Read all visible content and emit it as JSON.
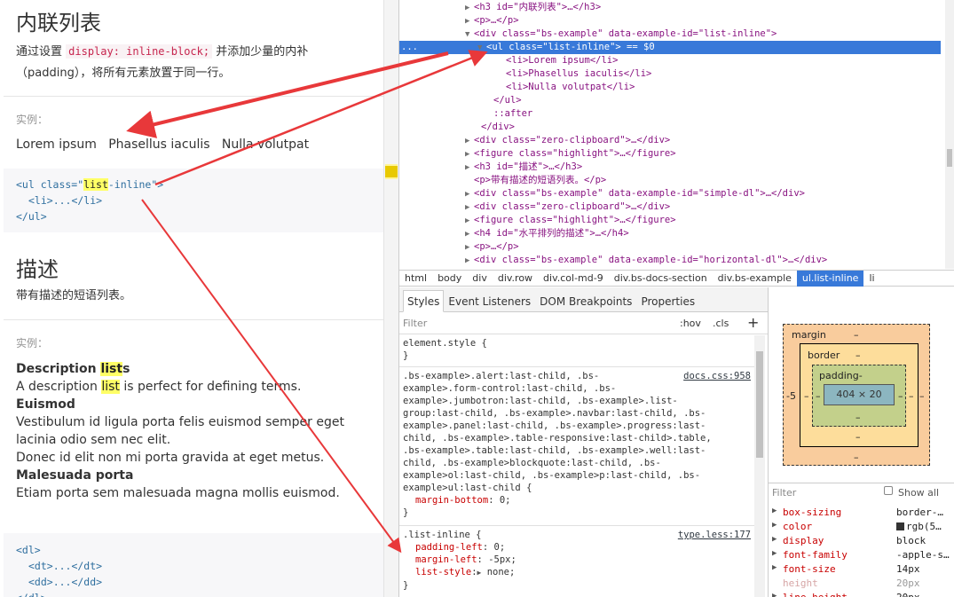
{
  "left": {
    "section1": {
      "title": "内联列表",
      "desc_prefix": "通过设置",
      "desc_code": "display: inline-block;",
      "desc_suffix1": "并添加少量的内补",
      "desc_suffix2": "（padding），将所有元素放置于同一行。"
    },
    "example_label": "实例：",
    "inline_items": [
      "Lorem ipsum",
      "Phasellus iaculis",
      "Nulla volutpat"
    ],
    "code1": {
      "line1_a": "<ul class=\"",
      "line1_hl": "list",
      "line1_b": "-inline\">",
      "line2": "<li>...</li>",
      "line3": "</ul>"
    },
    "section2": {
      "title": "描述",
      "desc": "带有描述的短语列表。"
    },
    "dl": {
      "term1_a": "Description ",
      "term1_hl": "list",
      "term1_b": "s",
      "def1_a": "A description ",
      "def1_hl": "list",
      "def1_b": " is perfect for defining terms.",
      "term2": "Euismod",
      "def2a": "Vestibulum id ligula porta felis euismod semper eget",
      "def2b": "lacinia odio sem nec elit.",
      "def2c": "Donec id elit non mi porta gravida at eget metus.",
      "term3": "Malesuada porta",
      "def3": "Etiam porta sem malesuada magna mollis euismod."
    },
    "code2": {
      "line1": "<dl>",
      "line2": "<dt>...</dt>",
      "line3": "<dd>...</dd>",
      "line4": "</dl>"
    }
  },
  "dom": {
    "rows": [
      "<h3 id=\"内联列表\">…</h3>",
      "<p>…</p>",
      "<div class=\"bs-example\" data-example-id=\"list-inline\">",
      "<ul class=\"list-inline\"> == $0",
      "<li>Lorem ipsum</li>",
      "<li>Phasellus iaculis</li>",
      "<li>Nulla volutpat</li>",
      "</ul>",
      "::after",
      "</div>",
      "<div class=\"zero-clipboard\">…</div>",
      "<figure class=\"highlight\">…</figure>",
      "<h3 id=\"描述\">…</h3>",
      "<p>带有描述的短语列表。</p>",
      "<div class=\"bs-example\" data-example-id=\"simple-dl\">…</div>",
      "<div class=\"zero-clipboard\">…</div>",
      "<figure class=\"highlight\">…</figure>",
      "<h4 id=\"水平排列的描述\">…</h4>",
      "<p>…</p>",
      "<div class=\"bs-example\" data-example-id=\"horizontal-dl\">…</div>"
    ],
    "ellipsis": "..."
  },
  "breadcrumbs": [
    "html",
    "body",
    "div",
    "div.row",
    "div.col-md-9",
    "div.bs-docs-section",
    "div.bs-example",
    "ul.list-inline",
    "li"
  ],
  "tabs": [
    "Styles",
    "Event Listeners",
    "DOM Breakpoints",
    "Properties"
  ],
  "styles": {
    "filter_placeholder": "Filter",
    "hov": ":hov",
    "cls": ".cls",
    "plus": "+",
    "element_style": "element.style {",
    "close": "}",
    "rule2_lines": [
      ".bs-example>.alert:last-child, .bs-",
      "example>.form-control:last-child, .bs-",
      "example>.jumbotron:last-child, .bs-example>.list-",
      "group:last-child, .bs-example>.navbar:last-child, .bs-",
      "example>.panel:last-child, .bs-example>.progress:last-",
      "child, .bs-example>.table-responsive:last-child>.table,",
      ".bs-example>.table:last-child, .bs-example>.well:last-",
      "child, .bs-example>blockquote:last-child, .bs-",
      "example>ol:last-child, .bs-example>p:last-child, .bs-",
      "example>ul:last-child {"
    ],
    "rule2_src": "docs.css:958",
    "rule2_prop": "margin-bottom",
    "rule2_val": "0;",
    "rule3_sel": ".list-inline {",
    "rule3_src": "type.less:177",
    "rule3_props": [
      {
        "k": "padding-left",
        "v": "0;"
      },
      {
        "k": "margin-left",
        "v": "-5px;"
      },
      {
        "k": "list-style",
        "v": "none;"
      }
    ]
  },
  "boxmodel": {
    "margin": "margin",
    "margin_top": "–",
    "margin_bottom": "–",
    "margin_left": "-5",
    "margin_right": "–",
    "border": "border",
    "border_top": "–",
    "border_bottom": "–",
    "border_left": "–",
    "border_right": "–",
    "padding": "padding-",
    "padding_bottom": "–",
    "padding_left": "–",
    "padding_right": "–",
    "content": "404 × 20"
  },
  "computed": {
    "filter": "Filter",
    "show_all": "Show all",
    "rows": [
      {
        "k": "box-sizing",
        "v": "border-…"
      },
      {
        "k": "color",
        "v": "rgb(5…"
      },
      {
        "k": "display",
        "v": "block"
      },
      {
        "k": "font-family",
        "v": "-apple-s…"
      },
      {
        "k": "font-size",
        "v": "14px"
      },
      {
        "k": "height",
        "v": "20px"
      },
      {
        "k": "line-height",
        "v": "20px"
      }
    ]
  },
  "colors": {
    "selection": "#3879d9",
    "arrow": "#e8383a",
    "margin_box": "#f9cc9d",
    "border_box": "#fddd9b",
    "padding_box": "#c3d08b",
    "content_box": "#8cb6c0"
  }
}
